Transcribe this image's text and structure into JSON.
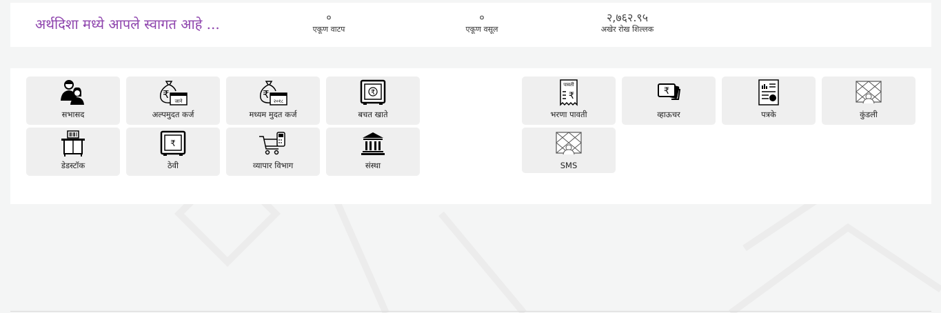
{
  "header": {
    "welcome": "अर्थदिशा मध्ये आपले स्वागत आहे ...",
    "stats": [
      {
        "value": "०",
        "label": "एकूण वाटप"
      },
      {
        "value": "०",
        "label": "एकूण वसूल"
      },
      {
        "value": "२,७६२.९५",
        "label": "अखेर रोख शिल्लक"
      }
    ]
  },
  "tiles": [
    {
      "label": "सभासद",
      "icon": "members-icon"
    },
    {
      "label": "अल्पमुदत कर्ज",
      "icon": "money-bag-icon",
      "icon_text": "जाने"
    },
    {
      "label": "मध्यम मुदत कर्ज",
      "icon": "money-bag-calendar-icon",
      "icon_text": "२०१८"
    },
    {
      "label": "बचत खाते",
      "icon": "safe-icon"
    },
    {
      "label": "भरणा पावती",
      "icon": "receipt-icon",
      "icon_text": "पावती"
    },
    {
      "label": "व्हाऊचर",
      "icon": "voucher-icon"
    },
    {
      "label": "पत्रके",
      "icon": "report-icon"
    },
    {
      "label": "कुंडली",
      "icon": "kundali-icon"
    },
    {
      "label": "डेडस्टॉक",
      "icon": "deadstock-icon"
    },
    {
      "label": "ठेवी",
      "icon": "deposit-icon"
    },
    {
      "label": "व्यापार विभाग",
      "icon": "trade-cart-icon"
    },
    {
      "label": "संस्था",
      "icon": "institution-icon"
    },
    {
      "label": "SMS",
      "icon": "sms-icon"
    }
  ]
}
